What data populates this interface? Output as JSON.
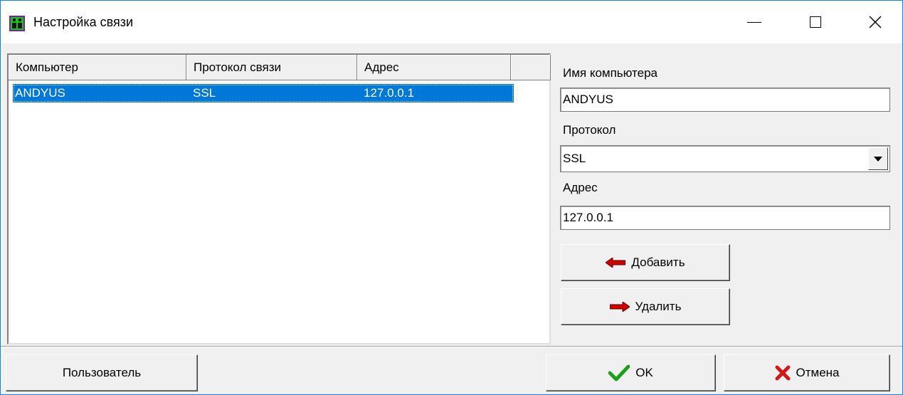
{
  "window": {
    "title": "Настройка связи",
    "close_glyph": "✕"
  },
  "list": {
    "columns": [
      "Компьютер",
      "Протокол связи",
      "Адрес"
    ],
    "rows": [
      {
        "computer": "ANDYUS",
        "protocol": "SSL",
        "address": "127.0.0.1"
      }
    ]
  },
  "form": {
    "computer_name_label": "Имя компьютера",
    "computer_name_value": "ANDYUS",
    "protocol_label": "Протокол",
    "protocol_value": "SSL",
    "address_label": "Адрес",
    "address_value": "127.0.0.1",
    "add_label": "Добавить",
    "delete_label": "Удалить"
  },
  "footer": {
    "user_label": "Пользователь",
    "ok_label": "OK",
    "cancel_label": "Отмена"
  },
  "colors": {
    "selection": "#0078d7",
    "ok_check": "#1aa11a",
    "cancel_x": "#d11919",
    "arrow_red": "#d10000"
  },
  "icons": [
    "app-icon",
    "minimize-icon",
    "maximize-icon",
    "close-icon",
    "arrow-left-icon",
    "arrow-right-icon",
    "check-icon",
    "cross-icon",
    "chevron-down-icon"
  ]
}
